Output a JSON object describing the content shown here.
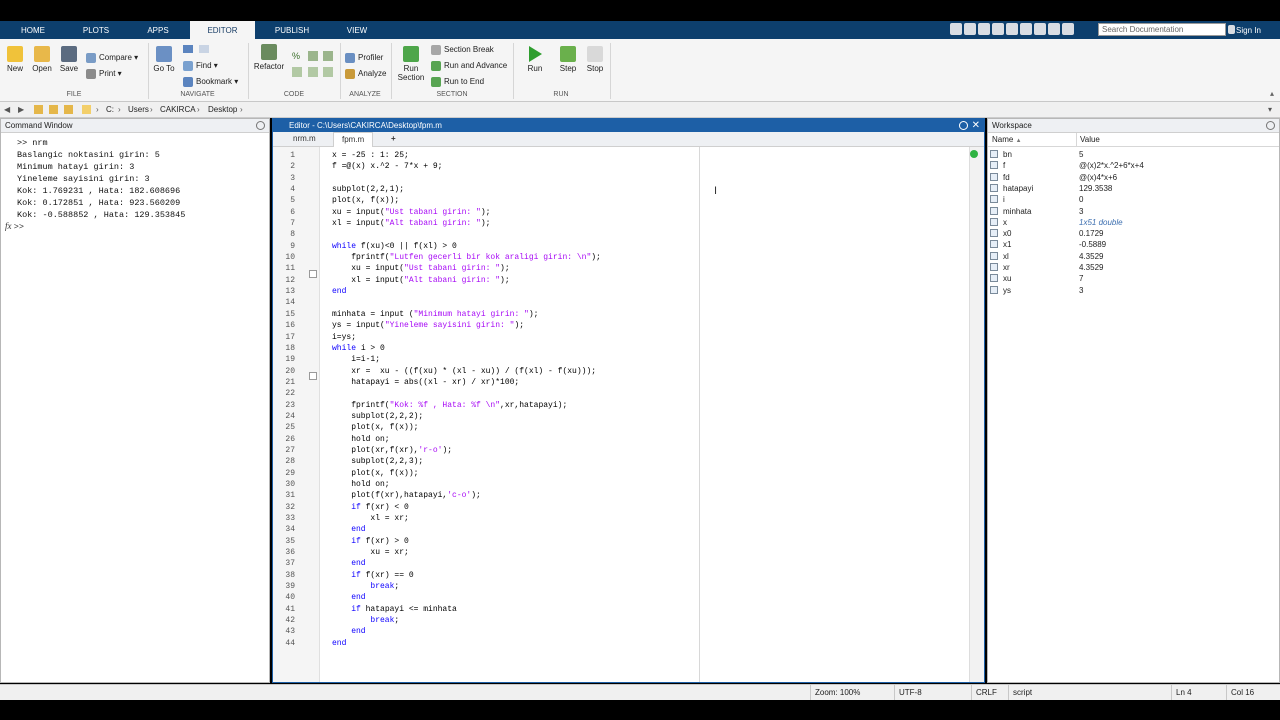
{
  "tabs": [
    "HOME",
    "PLOTS",
    "APPS",
    "EDITOR",
    "PUBLISH",
    "VIEW"
  ],
  "active_tab": "EDITOR",
  "search_placeholder": "Search Documentation",
  "sign_in": "Sign In",
  "ribbon": {
    "file": {
      "label": "FILE",
      "new": "New",
      "open": "Open",
      "save": "Save",
      "compare": "Compare",
      "print": "Print"
    },
    "navigate": {
      "label": "NAVIGATE",
      "goto": "Go To",
      "find": "Find",
      "bookmark": "Bookmark"
    },
    "code": {
      "label": "CODE",
      "refactor": "Refactor",
      "percent": "%"
    },
    "analyze": {
      "label": "ANALYZE",
      "profiler": "Profiler",
      "analyze": "Analyze"
    },
    "section": {
      "label": "SECTION",
      "run_section": "Run Section",
      "section_break": "Section Break",
      "run_and_advance": "Run and Advance",
      "run_to_end": "Run to End"
    },
    "run": {
      "label": "RUN",
      "run": "Run",
      "step": "Step",
      "stop": "Stop"
    }
  },
  "address": {
    "drive": "C:",
    "users": "Users",
    "user": "CAKIRCA",
    "desktop": "Desktop"
  },
  "command_window": {
    "title": "Command Window",
    "lines": [
      ">> nrm",
      "Baslangic noktasini girin: 5",
      "Minimum hatayi girin: 3",
      "Yineleme sayisini girin: 3",
      "Kok: 1.769231 , Hata: 182.608696",
      "Kok: 0.172851 , Hata: 923.560209",
      "Kok: -0.588852 , Hata: 129.353845"
    ],
    "prompt": ">>",
    "fx": "fx"
  },
  "editor": {
    "title": "Editor - C:\\Users\\CAKIRCA\\Desktop\\fpm.m",
    "tabs": [
      "nrm.m",
      "fpm.m"
    ],
    "add_tab": "+",
    "code": [
      "x = -25 : 1: 25;",
      "f =@(x) x.^2 - 7*x + 9;",
      "",
      "subplot(2,2,1);",
      "plot(x, f(x));",
      "xu = input(\"Ust tabani girin: \");",
      "xl = input(\"Alt tabani girin: \");",
      "",
      "while f(xu)<0 || f(xl) > 0",
      "    fprintf(\"Lutfen gecerli bir kok araligi girin: \\n\");",
      "    xu = input(\"Ust tabani girin: \");",
      "    xl = input(\"Alt tabani girin: \");",
      "end",
      "",
      "minhata = input (\"Minimum hatayi girin: \");",
      "ys = input(\"Yineleme sayisini girin: \");",
      "i=ys;",
      "while i > 0",
      "    i=i-1;",
      "    xr =  xu - ((f(xu) * (xl - xu)) / (f(xl) - f(xu)));",
      "    hatapayi = abs((xl - xr) / xr)*100;",
      "",
      "    fprintf(\"Kok: %f , Hata: %f \\n\",xr,hatapayi);",
      "    subplot(2,2,2);",
      "    plot(x, f(x));",
      "    hold on;",
      "    plot(xr,f(xr),'r-o');",
      "    subplot(2,2,3);",
      "    plot(x, f(x));",
      "    hold on;",
      "    plot(f(xr),hatapayi,'c-o');",
      "    if f(xr) < 0",
      "        xl = xr;",
      "    end",
      "    if f(xr) > 0",
      "        xu = xr;",
      "    end",
      "    if f(xr) == 0",
      "        break;",
      "    end",
      "    if hatapayi <= minhata",
      "        break;",
      "    end",
      "end"
    ]
  },
  "workspace": {
    "title": "Workspace",
    "col_name": "Name",
    "col_value": "Value",
    "vars": [
      {
        "name": "bn",
        "value": "5"
      },
      {
        "name": "f",
        "value": "@(x)2*x.^2+6*x+4"
      },
      {
        "name": "fd",
        "value": "@(x)4*x+6"
      },
      {
        "name": "hatapayi",
        "value": "129.3538"
      },
      {
        "name": "i",
        "value": "0"
      },
      {
        "name": "minhata",
        "value": "3"
      },
      {
        "name": "x",
        "value": "1x51 double"
      },
      {
        "name": "x0",
        "value": "0.1729"
      },
      {
        "name": "x1",
        "value": "-0.5889"
      },
      {
        "name": "xl",
        "value": "4.3529"
      },
      {
        "name": "xr",
        "value": "4.3529"
      },
      {
        "name": "xu",
        "value": "7"
      },
      {
        "name": "ys",
        "value": "3"
      }
    ]
  },
  "status": {
    "zoom": "Zoom: 100%",
    "encoding": "UTF-8",
    "eol": "CRLF",
    "type": "script",
    "ln": "Ln  4",
    "col": "Col  16"
  }
}
